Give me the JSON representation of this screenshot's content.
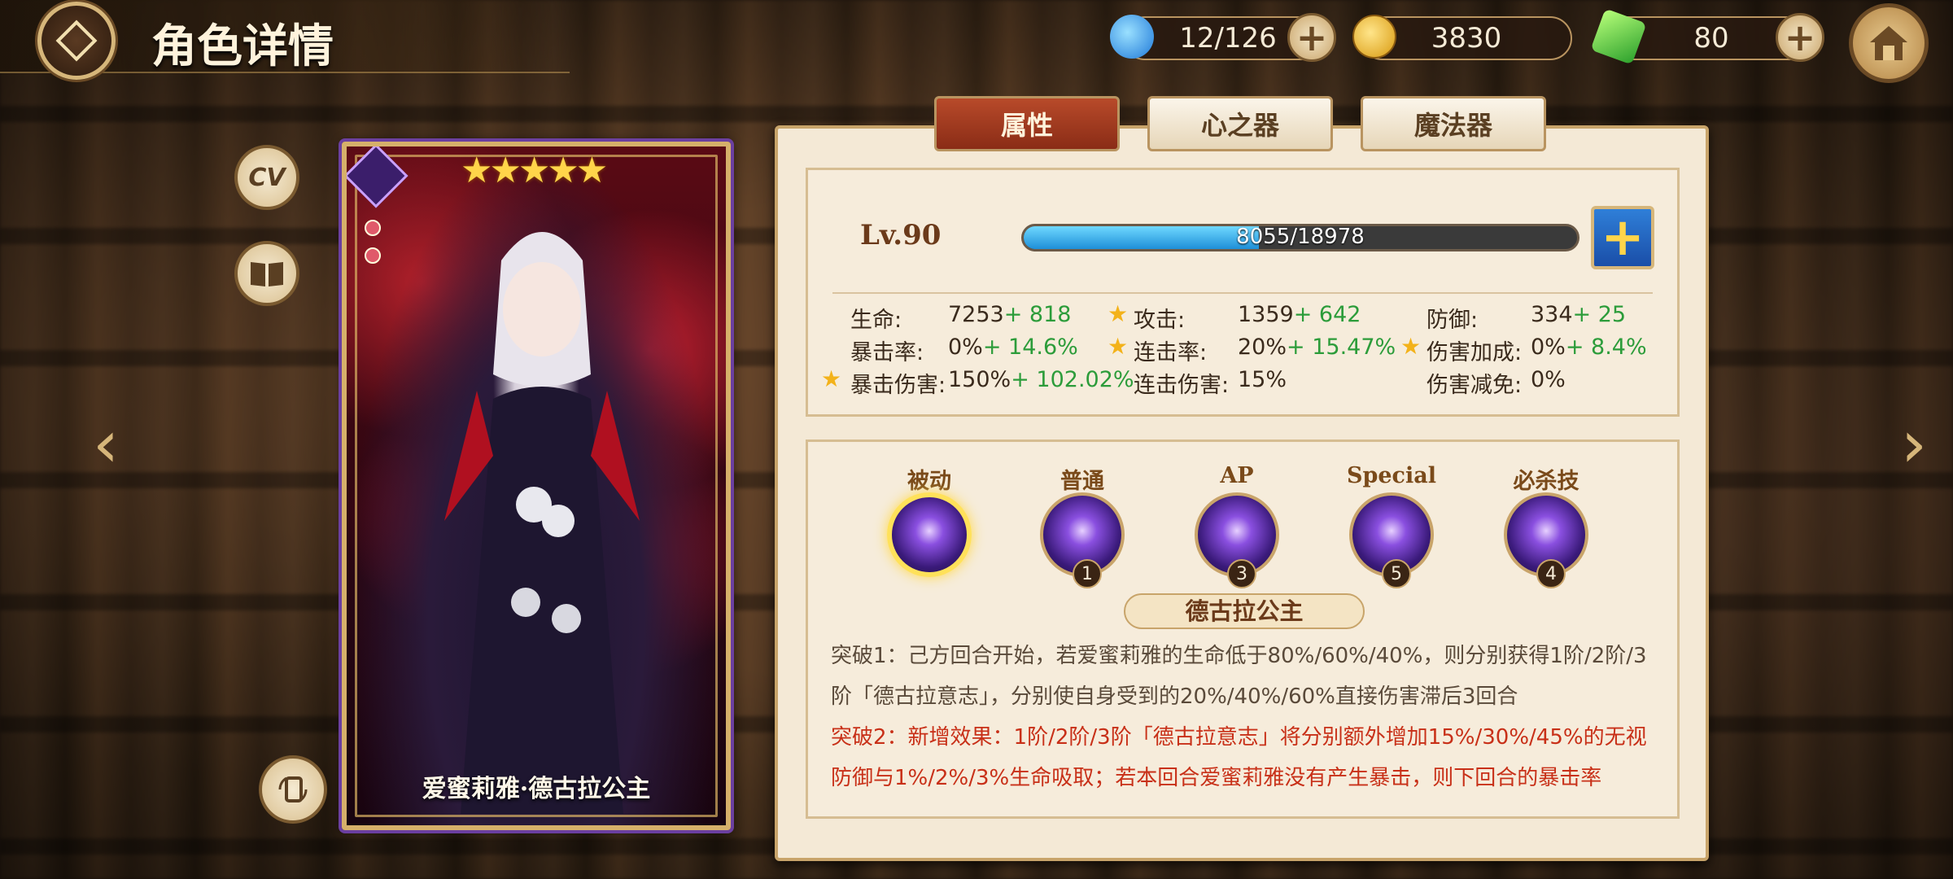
{
  "header": {
    "title": "角色详情"
  },
  "resources": [
    {
      "icon": "dragon-stamina-icon",
      "value": "12/126",
      "color": "#3aa0ff"
    },
    {
      "icon": "gold-coin-icon",
      "value": "3830",
      "color": "#f3b21a"
    },
    {
      "icon": "green-gem-icon",
      "value": "80",
      "color": "#5cd23a"
    }
  ],
  "side_buttons": {
    "cv_label": "CV"
  },
  "character": {
    "name": "爱蜜莉雅·德古拉公主",
    "stars": "★★★★★"
  },
  "tabs": [
    {
      "label": "属性",
      "active": true
    },
    {
      "label": "心之器",
      "active": false
    },
    {
      "label": "魔法器",
      "active": false
    }
  ],
  "level": {
    "label": "Lv.90",
    "xp_text": "8055/18978",
    "xp_current": 8055,
    "xp_max": 18978
  },
  "stats": [
    {
      "label": "生命:",
      "value": "7253",
      "bonus": "+ 818",
      "starred": false
    },
    {
      "label": "攻击:",
      "value": "1359",
      "bonus": "+ 642",
      "starred": true
    },
    {
      "label": "防御:",
      "value": "334",
      "bonus": "+ 25",
      "starred": false
    },
    {
      "label": "暴击率:",
      "value": "0%",
      "bonus": "+ 14.6%",
      "starred": false
    },
    {
      "label": "连击率:",
      "value": "20%",
      "bonus": "+ 15.47%",
      "starred": true
    },
    {
      "label": "伤害加成:",
      "value": "0%",
      "bonus": "+ 8.4%",
      "starred": true
    },
    {
      "label": "暴击伤害:",
      "value": "150%",
      "bonus": "+ 102.02%",
      "starred": true
    },
    {
      "label": "连击伤害:",
      "value": "15%",
      "bonus": "",
      "starred": false
    },
    {
      "label": "伤害减免:",
      "value": "0%",
      "bonus": "",
      "starred": false
    }
  ],
  "skills": [
    {
      "label": "被动",
      "level": "",
      "selected": true
    },
    {
      "label": "普通",
      "level": "1",
      "selected": false
    },
    {
      "label": "AP",
      "level": "3",
      "selected": false
    },
    {
      "label": "Special",
      "level": "5",
      "selected": false
    },
    {
      "label": "必杀技",
      "level": "4",
      "selected": false
    }
  ],
  "selected_skill": {
    "name": "德古拉公主",
    "desc_1": "突破1：己方回合开始，若爱蜜莉雅的生命低于80%/60%/40%，则分别获得1阶/2阶/3阶「德古拉意志」，分别使自身受到的20%/40%/60%直接伤害滞后3回合",
    "desc_2": "突破2：新增效果：1阶/2阶/3阶「德古拉意志」将分别额外增加15%/30%/45%的无视防御与1%/2%/3%生命吸取；若本回合爱蜜莉雅没有产生暴击，则下回合的暴击率"
  }
}
